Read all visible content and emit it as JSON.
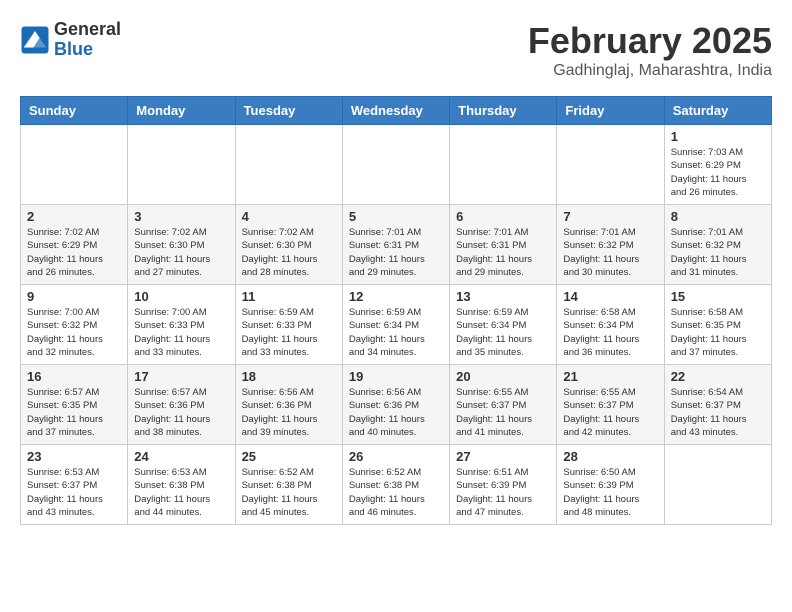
{
  "header": {
    "logo_line1": "General",
    "logo_line2": "Blue",
    "title": "February 2025",
    "subtitle": "Gadhinglaj, Maharashtra, India"
  },
  "columns": [
    "Sunday",
    "Monday",
    "Tuesday",
    "Wednesday",
    "Thursday",
    "Friday",
    "Saturday"
  ],
  "weeks": [
    {
      "days": [
        {
          "num": "",
          "info": ""
        },
        {
          "num": "",
          "info": ""
        },
        {
          "num": "",
          "info": ""
        },
        {
          "num": "",
          "info": ""
        },
        {
          "num": "",
          "info": ""
        },
        {
          "num": "",
          "info": ""
        },
        {
          "num": "1",
          "info": "Sunrise: 7:03 AM\nSunset: 6:29 PM\nDaylight: 11 hours and 26 minutes."
        }
      ]
    },
    {
      "days": [
        {
          "num": "2",
          "info": "Sunrise: 7:02 AM\nSunset: 6:29 PM\nDaylight: 11 hours and 26 minutes."
        },
        {
          "num": "3",
          "info": "Sunrise: 7:02 AM\nSunset: 6:30 PM\nDaylight: 11 hours and 27 minutes."
        },
        {
          "num": "4",
          "info": "Sunrise: 7:02 AM\nSunset: 6:30 PM\nDaylight: 11 hours and 28 minutes."
        },
        {
          "num": "5",
          "info": "Sunrise: 7:01 AM\nSunset: 6:31 PM\nDaylight: 11 hours and 29 minutes."
        },
        {
          "num": "6",
          "info": "Sunrise: 7:01 AM\nSunset: 6:31 PM\nDaylight: 11 hours and 29 minutes."
        },
        {
          "num": "7",
          "info": "Sunrise: 7:01 AM\nSunset: 6:32 PM\nDaylight: 11 hours and 30 minutes."
        },
        {
          "num": "8",
          "info": "Sunrise: 7:01 AM\nSunset: 6:32 PM\nDaylight: 11 hours and 31 minutes."
        }
      ]
    },
    {
      "days": [
        {
          "num": "9",
          "info": "Sunrise: 7:00 AM\nSunset: 6:32 PM\nDaylight: 11 hours and 32 minutes."
        },
        {
          "num": "10",
          "info": "Sunrise: 7:00 AM\nSunset: 6:33 PM\nDaylight: 11 hours and 33 minutes."
        },
        {
          "num": "11",
          "info": "Sunrise: 6:59 AM\nSunset: 6:33 PM\nDaylight: 11 hours and 33 minutes."
        },
        {
          "num": "12",
          "info": "Sunrise: 6:59 AM\nSunset: 6:34 PM\nDaylight: 11 hours and 34 minutes."
        },
        {
          "num": "13",
          "info": "Sunrise: 6:59 AM\nSunset: 6:34 PM\nDaylight: 11 hours and 35 minutes."
        },
        {
          "num": "14",
          "info": "Sunrise: 6:58 AM\nSunset: 6:34 PM\nDaylight: 11 hours and 36 minutes."
        },
        {
          "num": "15",
          "info": "Sunrise: 6:58 AM\nSunset: 6:35 PM\nDaylight: 11 hours and 37 minutes."
        }
      ]
    },
    {
      "days": [
        {
          "num": "16",
          "info": "Sunrise: 6:57 AM\nSunset: 6:35 PM\nDaylight: 11 hours and 37 minutes."
        },
        {
          "num": "17",
          "info": "Sunrise: 6:57 AM\nSunset: 6:36 PM\nDaylight: 11 hours and 38 minutes."
        },
        {
          "num": "18",
          "info": "Sunrise: 6:56 AM\nSunset: 6:36 PM\nDaylight: 11 hours and 39 minutes."
        },
        {
          "num": "19",
          "info": "Sunrise: 6:56 AM\nSunset: 6:36 PM\nDaylight: 11 hours and 40 minutes."
        },
        {
          "num": "20",
          "info": "Sunrise: 6:55 AM\nSunset: 6:37 PM\nDaylight: 11 hours and 41 minutes."
        },
        {
          "num": "21",
          "info": "Sunrise: 6:55 AM\nSunset: 6:37 PM\nDaylight: 11 hours and 42 minutes."
        },
        {
          "num": "22",
          "info": "Sunrise: 6:54 AM\nSunset: 6:37 PM\nDaylight: 11 hours and 43 minutes."
        }
      ]
    },
    {
      "days": [
        {
          "num": "23",
          "info": "Sunrise: 6:53 AM\nSunset: 6:37 PM\nDaylight: 11 hours and 43 minutes."
        },
        {
          "num": "24",
          "info": "Sunrise: 6:53 AM\nSunset: 6:38 PM\nDaylight: 11 hours and 44 minutes."
        },
        {
          "num": "25",
          "info": "Sunrise: 6:52 AM\nSunset: 6:38 PM\nDaylight: 11 hours and 45 minutes."
        },
        {
          "num": "26",
          "info": "Sunrise: 6:52 AM\nSunset: 6:38 PM\nDaylight: 11 hours and 46 minutes."
        },
        {
          "num": "27",
          "info": "Sunrise: 6:51 AM\nSunset: 6:39 PM\nDaylight: 11 hours and 47 minutes."
        },
        {
          "num": "28",
          "info": "Sunrise: 6:50 AM\nSunset: 6:39 PM\nDaylight: 11 hours and 48 minutes."
        },
        {
          "num": "",
          "info": ""
        }
      ]
    }
  ]
}
